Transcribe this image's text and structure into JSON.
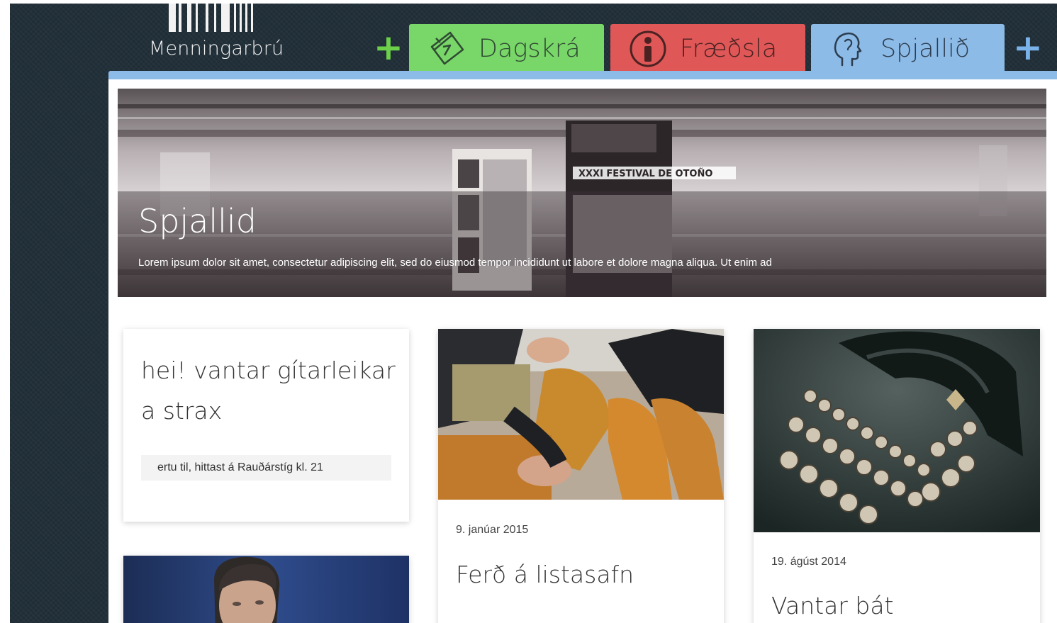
{
  "logo": {
    "text": "Menningarbrú"
  },
  "tabs": [
    {
      "label": "Dagskrá",
      "icon": "calendar-icon",
      "color": "#79d668"
    },
    {
      "label": "Fræðsla",
      "icon": "info-icon",
      "color": "#df5757"
    },
    {
      "label": "Spjallið",
      "icon": "head-icon",
      "color": "#8dbbe7"
    }
  ],
  "add_labels": {
    "green": "+",
    "blue": "+"
  },
  "hero": {
    "title": "Spjallid",
    "description": "Lorem ipsum dolor sit amet, consectetur adipiscing elit, sed do eiusmod tempor incididunt ut labore et dolore magna aliqua. Ut enim ad"
  },
  "cards": [
    {
      "title": "hei! vantar gítarleikar a strax",
      "subtitle": "ertu til, hittast á Rauðárstíg kl. 21"
    },
    {
      "date": "9. janúar 2015",
      "title": "Ferð á listasafn"
    },
    {
      "date": "19. ágúst 2014",
      "title": "Vantar bát"
    }
  ],
  "colors": {
    "background": "#223039",
    "accent": "#8dbbe7",
    "green": "#79d668",
    "red": "#df5757"
  }
}
